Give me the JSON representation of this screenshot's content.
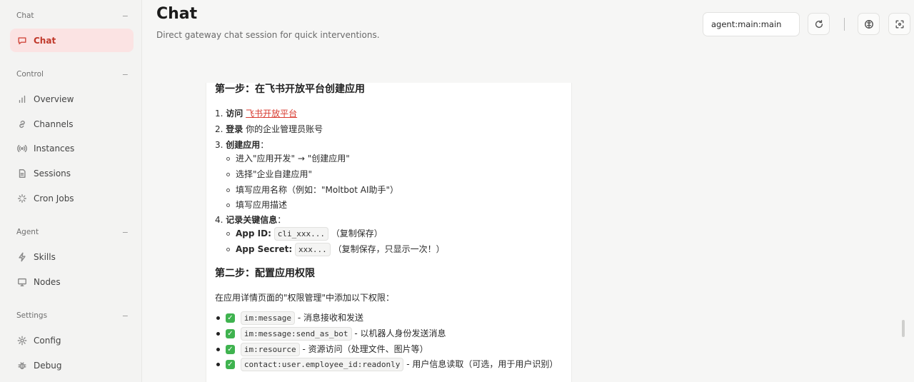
{
  "sidebar": {
    "groups": [
      {
        "label": "Chat",
        "items": [
          {
            "label": "Chat",
            "icon": "chat-bubble-icon",
            "active": true
          }
        ]
      },
      {
        "label": "Control",
        "items": [
          {
            "label": "Overview",
            "icon": "bar-chart-icon"
          },
          {
            "label": "Channels",
            "icon": "link-icon"
          },
          {
            "label": "Instances",
            "icon": "radio-icon"
          },
          {
            "label": "Sessions",
            "icon": "document-icon"
          },
          {
            "label": "Cron Jobs",
            "icon": "loader-icon"
          }
        ]
      },
      {
        "label": "Agent",
        "items": [
          {
            "label": "Skills",
            "icon": "lightning-icon"
          },
          {
            "label": "Nodes",
            "icon": "monitor-icon"
          }
        ]
      },
      {
        "label": "Settings",
        "items": [
          {
            "label": "Config",
            "icon": "gear-icon"
          },
          {
            "label": "Debug",
            "icon": "bug-icon"
          }
        ]
      }
    ],
    "collapse_glyph": "−"
  },
  "header": {
    "title": "Chat",
    "subtitle": "Direct gateway chat session for quick interventions.",
    "session_value": "agent:main:main"
  },
  "message": {
    "step1_heading": "第一步：在飞书开放平台创建应用",
    "items": {
      "i1_num": "1.",
      "i1_bold": "访问",
      "i1_link": "飞书开放平台",
      "i2_num": "2.",
      "i2_bold": "登录",
      "i2_text": "你的企业管理员账号",
      "i3_num": "3.",
      "i3_bold": "创建应用",
      "i3_sub": [
        "进入\"应用开发\" → \"创建应用\"",
        "选择\"企业自建应用\"",
        "填写应用名称（例如：\"Moltbot AI助手\"）",
        "填写应用描述"
      ],
      "i4_num": "4.",
      "i4_bold": "记录关键信息",
      "i4_sub1_label": "App ID",
      "i4_sub1_code": "cli_xxx...",
      "i4_sub1_note": "（复制保存）",
      "i4_sub2_label": "App Secret",
      "i4_sub2_code": "xxx...",
      "i4_sub2_note": "（复制保存，只显示一次！）",
      "colon": "："
    },
    "step2_heading": "第二步：配置应用权限",
    "step2_intro": "在应用详情页面的\"权限管理\"中添加以下权限：",
    "permissions": [
      {
        "code": "im:message",
        "desc": "- 消息接收和发送"
      },
      {
        "code": "im:message:send_as_bot",
        "desc": "- 以机器人身份发送消息"
      },
      {
        "code": "im:resource",
        "desc": "- 资源访问（处理文件、图片等）"
      },
      {
        "code": "contact:user.employee_id:readonly",
        "desc": "- 用户信息读取（可选，用于用户识别）"
      }
    ],
    "check_glyph": "✓"
  }
}
